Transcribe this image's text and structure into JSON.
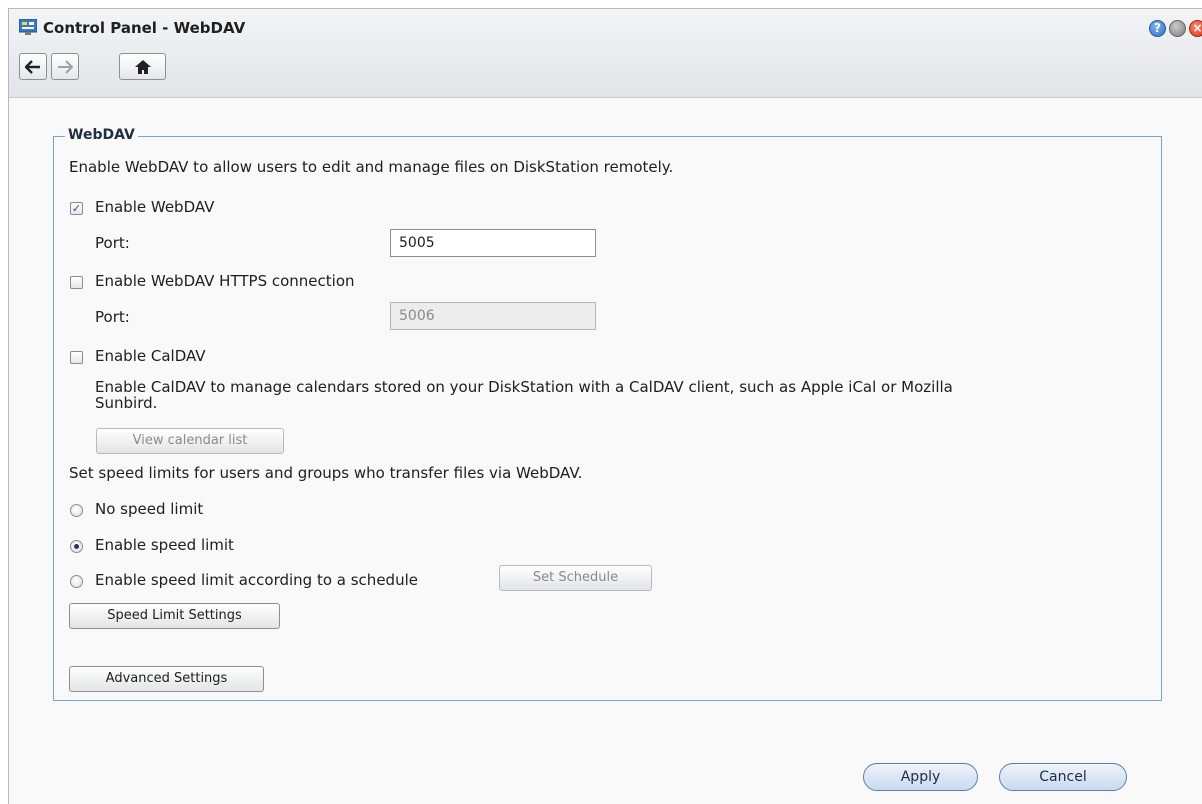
{
  "window": {
    "title": "Control Panel - WebDAV"
  },
  "section": {
    "legend": "WebDAV",
    "description": "Enable WebDAV to allow users to edit and manage files on DiskStation remotely."
  },
  "webdav": {
    "enable_label": "Enable WebDAV",
    "enabled": true,
    "port_label": "Port:",
    "port_value": "5005"
  },
  "https": {
    "enable_label": "Enable WebDAV HTTPS connection",
    "enabled": false,
    "port_label": "Port:",
    "port_value": "5006"
  },
  "caldav": {
    "enable_label": "Enable CalDAV",
    "enabled": false,
    "description_line1": "Enable CalDAV to manage calendars stored on your DiskStation with a CalDAV client, such as Apple iCal or Mozilla",
    "description_line2": "Sunbird.",
    "view_calendar_label": "View calendar list"
  },
  "speed": {
    "description": "Set speed limits for users and groups who transfer files via WebDAV.",
    "options": [
      {
        "label": "No speed limit",
        "selected": false
      },
      {
        "label": "Enable speed limit",
        "selected": true
      },
      {
        "label": "Enable speed limit according to a schedule",
        "selected": false
      }
    ],
    "set_schedule_label": "Set Schedule",
    "settings_label": "Speed Limit Settings"
  },
  "advanced_label": "Advanced Settings",
  "footer": {
    "apply_label": "Apply",
    "cancel_label": "Cancel"
  },
  "colors": {
    "accent_border": "#7aa3cd",
    "close": "#d7321a",
    "help": "#2f6fc4"
  }
}
